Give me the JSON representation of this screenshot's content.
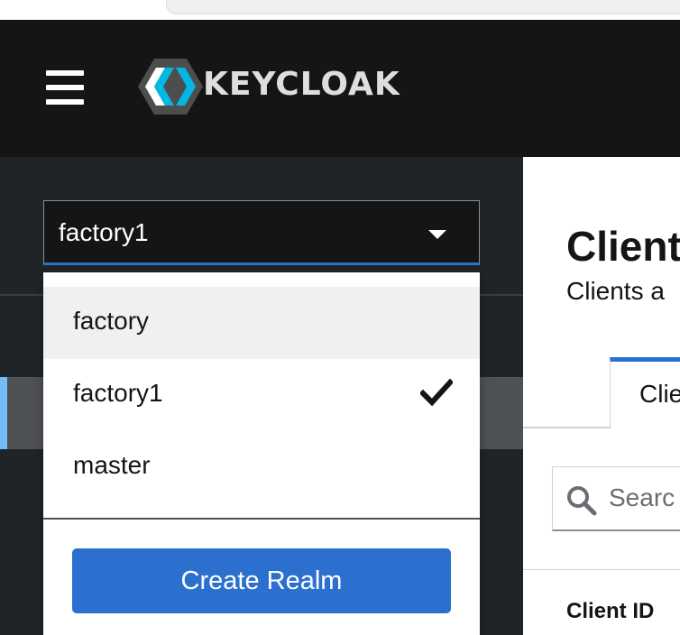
{
  "masthead": {
    "logo_text": "KEYCLOAK"
  },
  "realm_selector": {
    "selected": "factory1",
    "options": [
      {
        "label": "factory",
        "state": "hovered"
      },
      {
        "label": "factory1",
        "state": "selected"
      },
      {
        "label": "master",
        "state": "normal"
      }
    ],
    "create_button_label": "Create Realm"
  },
  "main": {
    "title": "Client",
    "subtitle": "Clients a",
    "active_tab_label": "Clie",
    "search": {
      "placeholder": "Searc",
      "value": ""
    },
    "table": {
      "columns": [
        "Client ID"
      ]
    }
  },
  "colors": {
    "masthead_bg": "#151515",
    "sidebar_bg": "#212427",
    "accent_blue": "#2b6fcf",
    "active_marker": "#73bcf7"
  },
  "icons": [
    "hamburger-menu-icon",
    "keycloak-logo-icon",
    "caret-down-icon",
    "checkmark-icon",
    "search-icon"
  ]
}
